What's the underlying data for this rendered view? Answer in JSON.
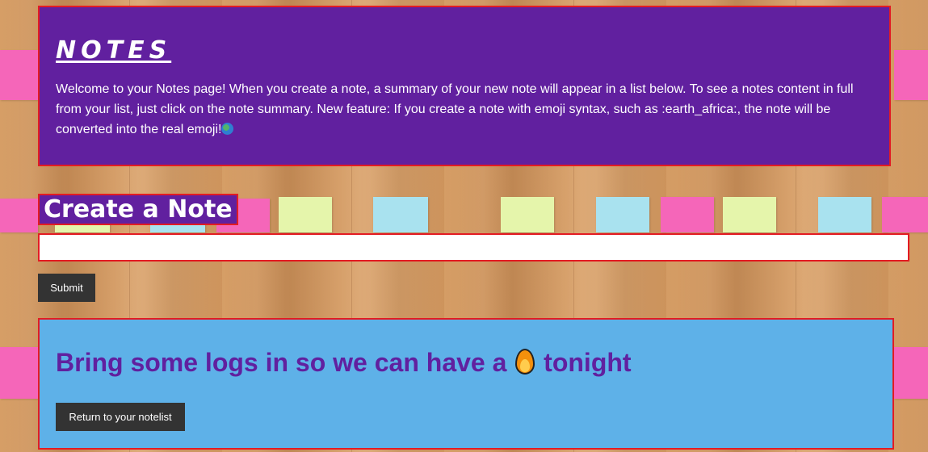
{
  "header": {
    "title": "NOTES",
    "welcome_text": "Welcome to your Notes page! When you create a note, a summary of your new note will appear in a list below. To see a notes content in full from your list, just click on the note summary. New feature: If you create a note with emoji syntax, such as :earth_africa:, the note will be converted into the real emoji!",
    "emoji_icon": "earth-africa-icon"
  },
  "create": {
    "heading": "Create a Note",
    "input_value": "",
    "input_placeholder": "",
    "submit_label": "Submit"
  },
  "note": {
    "text_before": "Bring some logs in so we can have a",
    "emoji_icon": "fire-icon",
    "text_after": "tonight",
    "return_label": "Return to your notelist"
  },
  "colors": {
    "panel_purple": "#61209f",
    "panel_blue": "#5eb1e8",
    "border_red": "#e31b23",
    "button_dark": "#333333",
    "sticky_pink": "#f566b9",
    "sticky_yellow": "#e5f5ab",
    "sticky_blue": "#a9e2ef"
  }
}
